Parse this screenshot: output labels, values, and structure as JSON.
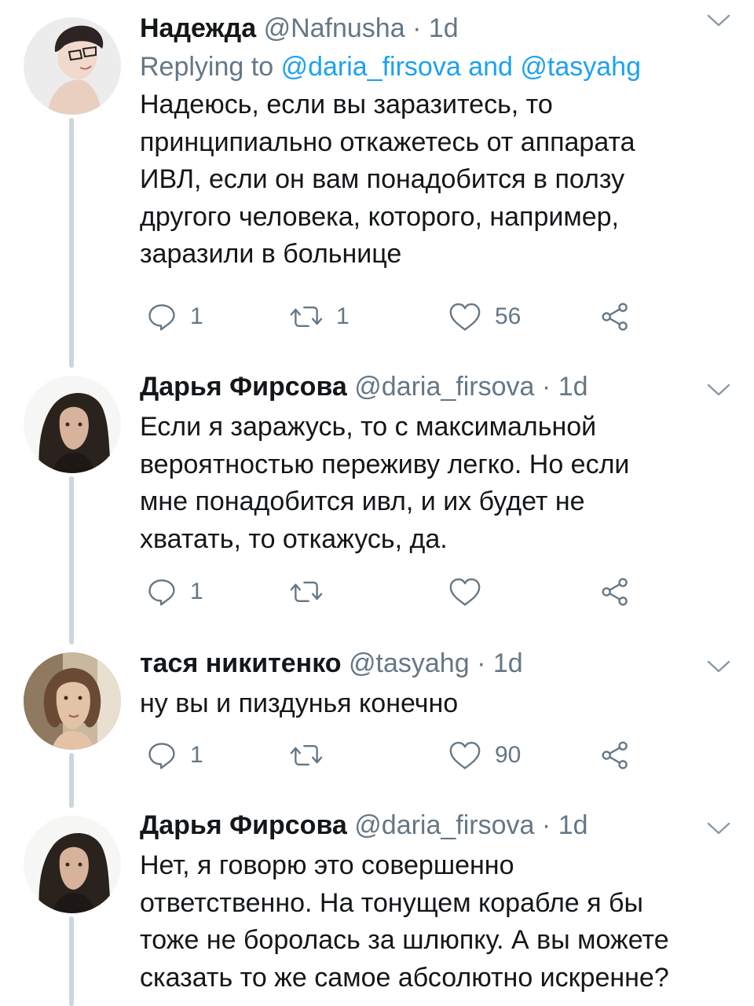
{
  "colors": {
    "text": "#14171a",
    "secondary": "#657786",
    "link": "#1da1f2",
    "thread_line": "#ccd6dd"
  },
  "icons": {
    "reply": "reply-icon",
    "retweet": "retweet-icon",
    "like": "heart-icon",
    "share": "share-icon",
    "menu": "chevron-down-icon"
  },
  "tweets": [
    {
      "name": "Надежда",
      "handle": "@Nafnusha",
      "dot": "·",
      "time": "1d",
      "replying_prefix": "Replying to",
      "replying_to_1": "@daria_firsova",
      "replying_and": "and",
      "replying_to_2": "@tasyahg",
      "text": "Надеюсь, если вы заразитесь, то\nпринципиально откажетесь от аппарата\nИВЛ, если он вам понадобится в ползу\nдругого человека, которого, например,\nзаразили в больнице",
      "replies": "1",
      "retweets": "1",
      "likes": "56"
    },
    {
      "name": "Дарья Фирсова",
      "handle": "@daria_firsova",
      "dot": "·",
      "time": "1d",
      "text": "Если я заражусь, то с максимальной\nвероятностью переживу легко. Но если\nмне понадобится ивл, и их будет не\nхватать, то откажусь, да.",
      "replies": "1",
      "retweets": "",
      "likes": ""
    },
    {
      "name": "тася никитенко",
      "handle": "@tasyahg",
      "dot": "·",
      "time": "1d",
      "text": "ну вы и пиздунья конечно",
      "replies": "1",
      "retweets": "",
      "likes": "90"
    },
    {
      "name": "Дарья Фирсова",
      "handle": "@daria_firsova",
      "dot": "·",
      "time": "1d",
      "text": "Нет, я говорю это совершенно\nответственно. На тонущем корабле я бы\nтоже не боролась за шлюпку. А вы можете\nсказать то же самое абсолютно искренне?"
    }
  ]
}
